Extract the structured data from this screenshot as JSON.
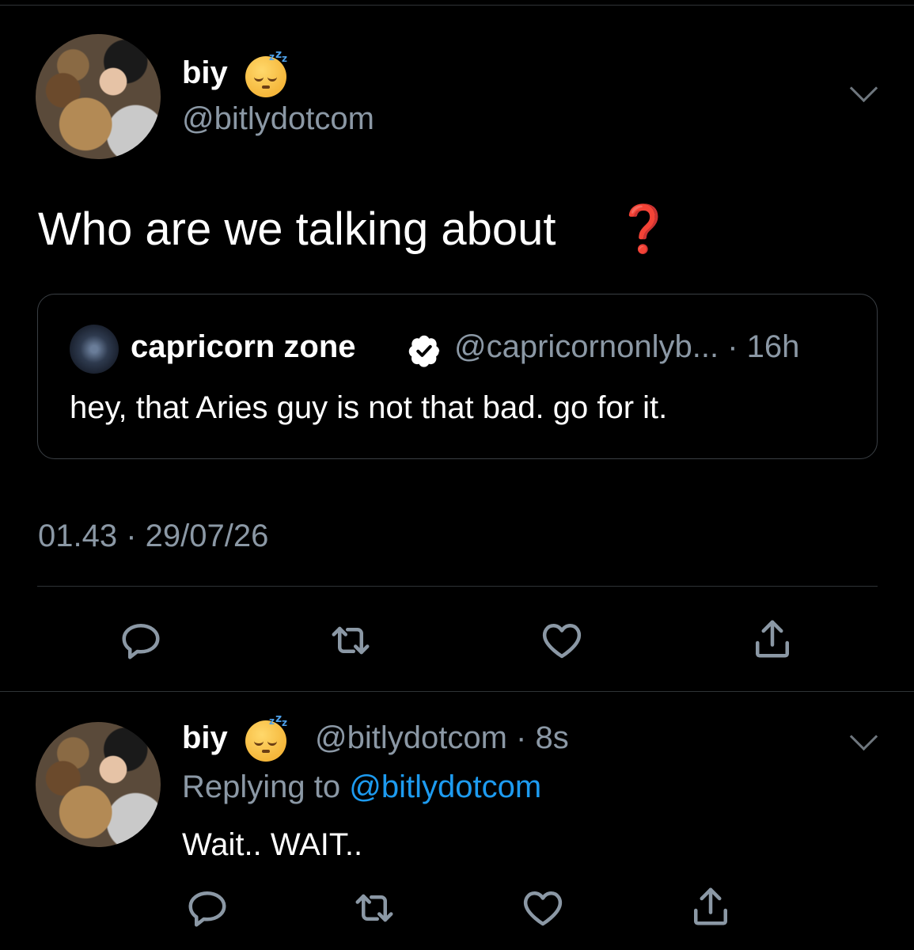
{
  "main_tweet": {
    "display_name": "biy",
    "handle": "@bitlydotcom",
    "text": "Who are we talking about",
    "emoji_text": "❓",
    "timestamp": "01.43 · 29/07/26",
    "quoted": {
      "display_name": "capricorn zone",
      "handle_time": "@capricornonlyb... · 16h",
      "text": "hey, that Aries guy is not that bad. go for it."
    }
  },
  "reply_tweet": {
    "display_name": "biy",
    "handle_time": "@bitlydotcom · 8s",
    "replying_prefix": "Replying to ",
    "replying_handle": "@bitlydotcom",
    "text": "Wait.. WAIT.."
  },
  "icons": {
    "reply": "reply-icon",
    "retweet": "retweet-icon",
    "like": "heart-icon",
    "share": "share-icon",
    "menu": "chevron-down-icon",
    "verified": "verified-badge-icon",
    "status_emoji": "sleeping-face-emoji"
  },
  "colors": {
    "background": "#000000",
    "secondary_text": "#8b98a5",
    "link": "#1d9bf0",
    "question_mark": "#e0202a"
  }
}
